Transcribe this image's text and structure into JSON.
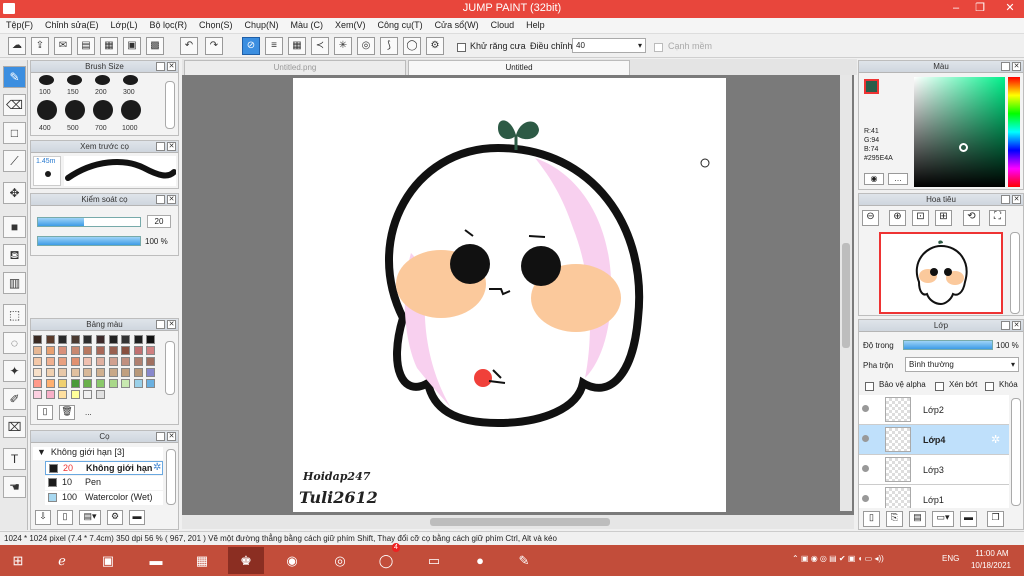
{
  "window": {
    "title": "JUMP PAINT (32bit)"
  },
  "menu": [
    "Tệp(F)",
    "Chỉnh sửa(E)",
    "Lớp(L)",
    "Bộ lọc(R)",
    "Chọn(S)",
    "Chụp(N)",
    "Màu (C)",
    "Xem(V)",
    "Công cụ(T)",
    "Cửa sổ(W)",
    "Cloud",
    "Help"
  ],
  "toolbar": {
    "antialias_label": "Khử răng cưa",
    "adjust_label": "Điều chỉnh",
    "adjust_value": "40",
    "edge_label": "Cạnh mềm"
  },
  "brush_size": {
    "title": "Brush Size",
    "sizes": [
      "100",
      "150",
      "200",
      "300",
      "400",
      "500",
      "700",
      "1000"
    ]
  },
  "preview": {
    "title": "Xem trước cọ",
    "size": "1.45m"
  },
  "control": {
    "title": "Kiểm soát cọ",
    "value1": "20",
    "value2": "100 %",
    "fill1": 0.45,
    "fill2": 1.0
  },
  "palette": {
    "title": "Bảng màu",
    "more": "...",
    "colors": [
      "#3a2a22",
      "#5a3a2a",
      "#2a2a2a",
      "#4a3a30",
      "#2c2c2c",
      "#3c2a2a",
      "#222222",
      "#333333",
      "#1e1e1e",
      "#111111",
      "#e8b894",
      "#e8a070",
      "#d8907a",
      "#c88870",
      "#b87860",
      "#a86858",
      "#986050",
      "#885040",
      "#c07070",
      "#d08080",
      "#f4c8a8",
      "#f0b090",
      "#e8a080",
      "#e09070",
      "#f0c0b0",
      "#e0b0a0",
      "#d0a090",
      "#c09080",
      "#b08070",
      "#a07060",
      "#f8e0c8",
      "#f0d0b0",
      "#e8c8a8",
      "#e0c0a0",
      "#d8b898",
      "#d0b090",
      "#c8a888",
      "#c0a080",
      "#b89878",
      "#8888cc",
      "#ff9a8a",
      "#ffb070",
      "#f0d070",
      "#4a9a3a",
      "#6ab04a",
      "#8ac86a",
      "#aad88a",
      "#c8e8b0",
      "#9ad0e8",
      "#6ab0e0",
      "#fcd0e0",
      "#f8b0c8",
      "#ffe0a0",
      "#ffff9a",
      "#f0f0f0",
      "#e0e0e0"
    ]
  },
  "brush": {
    "title": "Cọ",
    "group": "Không giới hạn [3]",
    "items": [
      {
        "size": "20",
        "name": "Không giới hạn",
        "color": "#1a1a1a"
      },
      {
        "size": "10",
        "name": "Pen",
        "color": "#1a1a1a"
      },
      {
        "size": "100",
        "name": "Watercolor (Wet)",
        "color": "#a8d8f0"
      }
    ]
  },
  "tabs": [
    "Untitled.png",
    "Untitled"
  ],
  "artwork": {
    "signature1": "Hoidap247",
    "signature2": "Tuli2612"
  },
  "color_panel": {
    "title": "Màu",
    "r": "R:41",
    "g": "G:94",
    "b": "B:74",
    "hex": "#295E4A"
  },
  "navigator": {
    "title": "Hoa tiêu"
  },
  "layer_panel": {
    "title": "Lớp",
    "opacity_label": "Độ trong",
    "opacity_value": "100 %",
    "opacity_fill": 1.0,
    "blend_label": "Pha trộn",
    "blend_value": "Bình thường",
    "alpha_label": "Bảo vệ alpha",
    "clip_label": "Xén bớt",
    "lock_label": "Khóa",
    "layers": [
      "Lớp2",
      "Lớp4",
      "Lớp3",
      "Lớp1"
    ]
  },
  "status": {
    "text": "1024 * 1024 pixel   (7.4 * 7.4cm)   350 dpi   56 %   ( 967, 201 )   Vẽ một đường thẳng bằng cách giữ phím Shift, Thay đổi cỡ cọ bằng cách giữ phím Ctrl, Alt và kéo"
  },
  "taskbar": {
    "lang": "ENG",
    "time": "11:00 AM",
    "date": "10/18/2021",
    "zalo_badge": "4"
  }
}
